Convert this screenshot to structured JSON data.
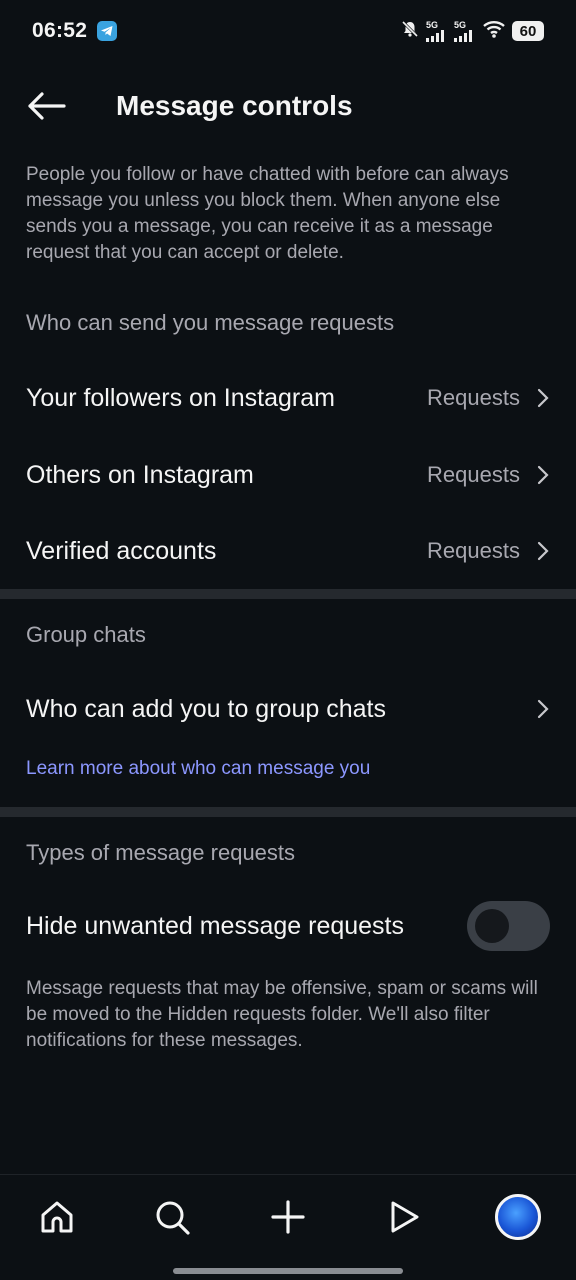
{
  "status_bar": {
    "time": "06:52",
    "signal_1": "5G",
    "signal_2": "5G",
    "battery": "60"
  },
  "header": {
    "title": "Message controls"
  },
  "intro_text": "People you follow or have chatted with before can always message you unless you block them. When anyone else sends you a message, you can receive it as a message request that you can accept or delete.",
  "requests_section": {
    "title": "Who can send you message requests",
    "items": [
      {
        "label": "Your followers on Instagram",
        "value": "Requests"
      },
      {
        "label": "Others on Instagram",
        "value": "Requests"
      },
      {
        "label": "Verified accounts",
        "value": "Requests"
      }
    ]
  },
  "group_section": {
    "title": "Group chats",
    "item_label": "Who can add you to group chats",
    "link": "Learn more about who can message you"
  },
  "types_section": {
    "title": "Types of message requests",
    "toggle_label": "Hide unwanted message requests",
    "toggle_on": false,
    "footnote": "Message requests that may be offensive, spam or scams will be moved to the Hidden requests folder. We'll also filter notifications for these messages."
  },
  "bottom_nav": {
    "items": [
      "home-icon",
      "search-icon",
      "create-icon",
      "reels-icon",
      "profile-avatar"
    ]
  },
  "colors": {
    "background": "#0c1014",
    "link": "#8c97ff",
    "muted_text": "#a8a8b0"
  }
}
